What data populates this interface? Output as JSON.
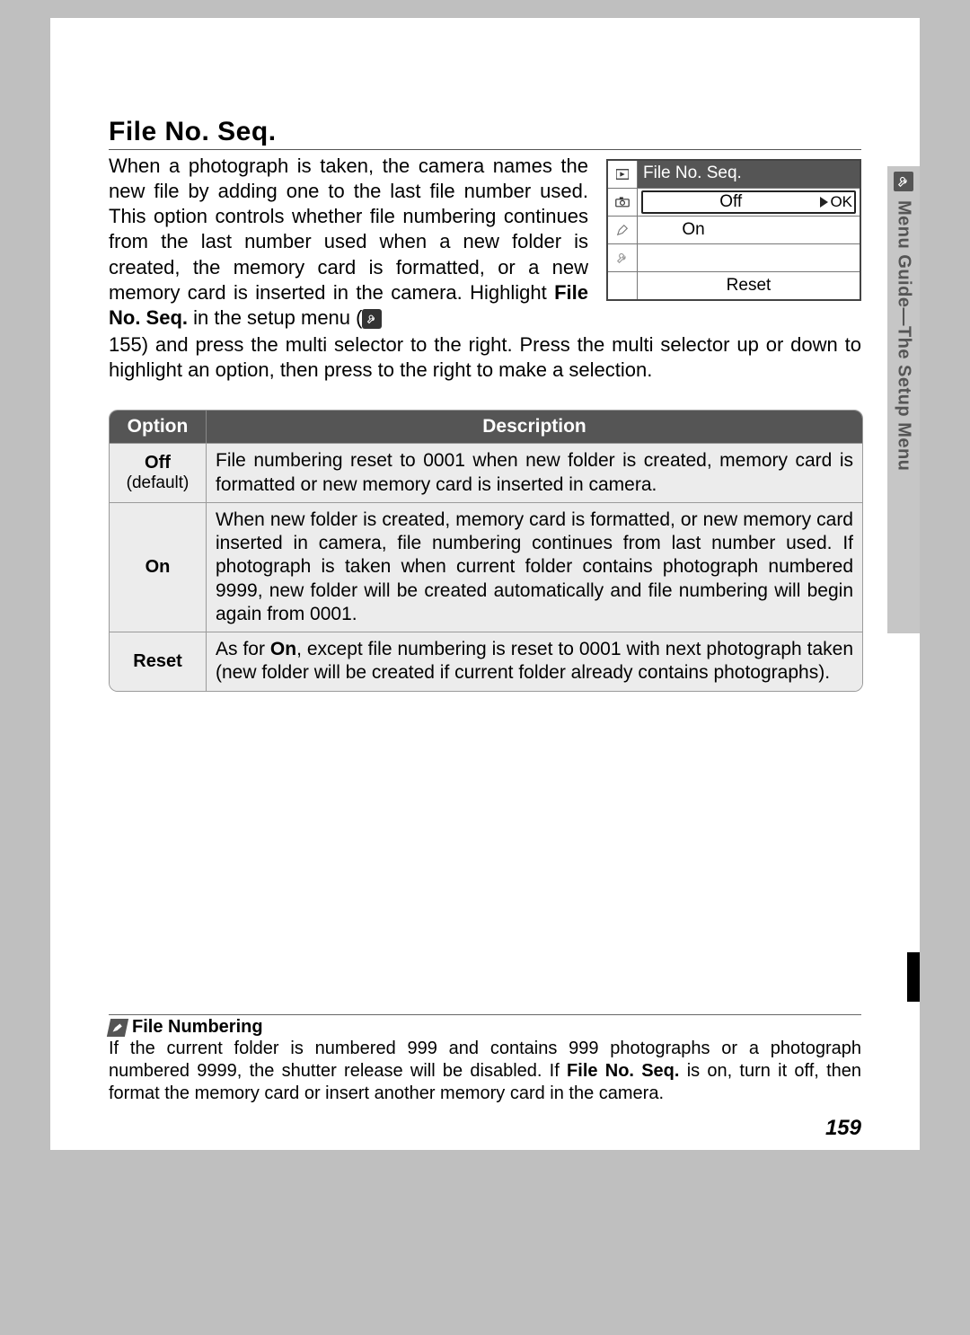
{
  "sideTab": {
    "label": "Menu Guide—The Setup Menu"
  },
  "title": "File No. Seq.",
  "intro": {
    "p1a": "When a photograph is taken, the camera names the new file by adding one to the last file number used.  This option controls whether file numbering continues from the last number used when a new folder is created, the memory card is formatted, or a new memory card is inserted in the camera. Highlight ",
    "p1b": "File No. Seq.",
    "p1c": " in the setup menu ("
  },
  "followup": " 155) and press the multi selector to the right.  Press the multi selector up or down to highlight an option, then press to the right to make a selection.",
  "lcd": {
    "title": "File No. Seq.",
    "opt_off": "Off",
    "ok": "OK",
    "opt_on": "On",
    "opt_reset": "Reset"
  },
  "table": {
    "head_option": "Option",
    "head_desc": "Description",
    "rows": [
      {
        "name": "Off",
        "sub": "(default)",
        "desc": "File numbering reset to 0001 when new folder is created, memory card is formatted or new memory card is inserted in camera."
      },
      {
        "name": "On",
        "sub": "",
        "desc": "When new folder is created, memory card is formatted, or new memory card inserted in camera, file numbering continues from last number used. If photograph is taken when current folder contains photograph numbered 9999, new folder will be created automatically and file numbering will begin again from 0001."
      },
      {
        "name": "Reset",
        "sub": "",
        "desc_pre": "As for ",
        "desc_bold": "On",
        "desc_post": ", except file numbering is reset to 0001 with next photograph taken (new folder will be created if current folder already contains photographs)."
      }
    ]
  },
  "note": {
    "title": "File Numbering",
    "body_a": "If the current folder is numbered 999 and contains 999 photographs or a photograph numbered 9999, the shutter release will be disabled.  If ",
    "body_bold": "File No. Seq.",
    "body_b": " is on, turn it off, then format the memory card or insert another memory card in the camera."
  },
  "pageNumber": "159"
}
